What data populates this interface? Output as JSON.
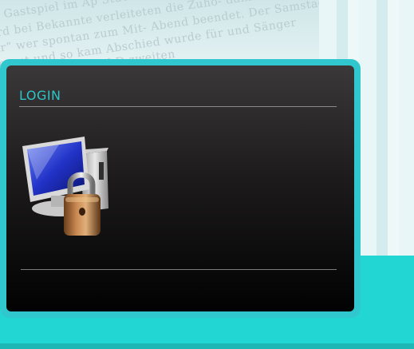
{
  "login": {
    "title": "LOGIN"
  },
  "background": {
    "newspaper_lines": [
      "e Gastspiel im Ap   Stücke   zwei  Zugabe  dieser",
      "ird bei  Bekannte  verleiteten die Zuhö-  dann  auch  ZUM DRITT",
      "hr”  wer spontan zum Mit-  Abend  beendet. Der  Samstag der",
      "so gut  und  so  kam  Abschied  wurde  für  und Sänger",
      "   wurde  leichter, weil D  zweiten"
    ]
  },
  "colors": {
    "accent": "#2ec5c8",
    "frame": "#30c7cf",
    "band": "#22d6d4"
  },
  "icons": [
    "computer-lock-icon"
  ]
}
